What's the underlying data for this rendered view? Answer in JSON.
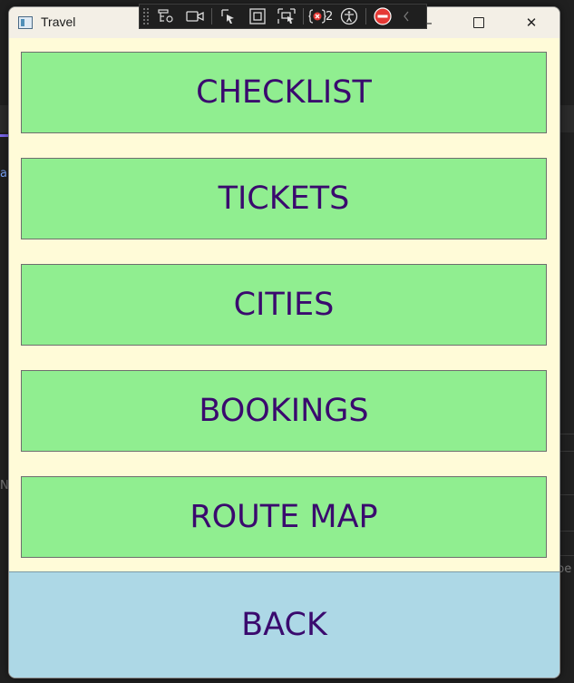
{
  "window": {
    "title": "Travel",
    "controls": {
      "minimize": "–",
      "close": "✕"
    }
  },
  "debug_toolbar": {
    "binding_failures_count": "2"
  },
  "menu": {
    "items": [
      {
        "label": "CHECKLIST"
      },
      {
        "label": "TICKETS"
      },
      {
        "label": "CITIES"
      },
      {
        "label": "BOOKINGS"
      },
      {
        "label": "ROUTE MAP"
      }
    ],
    "back_label": "BACK"
  },
  "background_app": {
    "glyph_a": "a",
    "glyph_n": "N",
    "glyph_pe": "pe"
  },
  "colors": {
    "window_bg": "#fffbd8",
    "menu_button_bg": "#90ee90",
    "back_button_bg": "#add8e6",
    "button_text": "#3a0a6e"
  }
}
